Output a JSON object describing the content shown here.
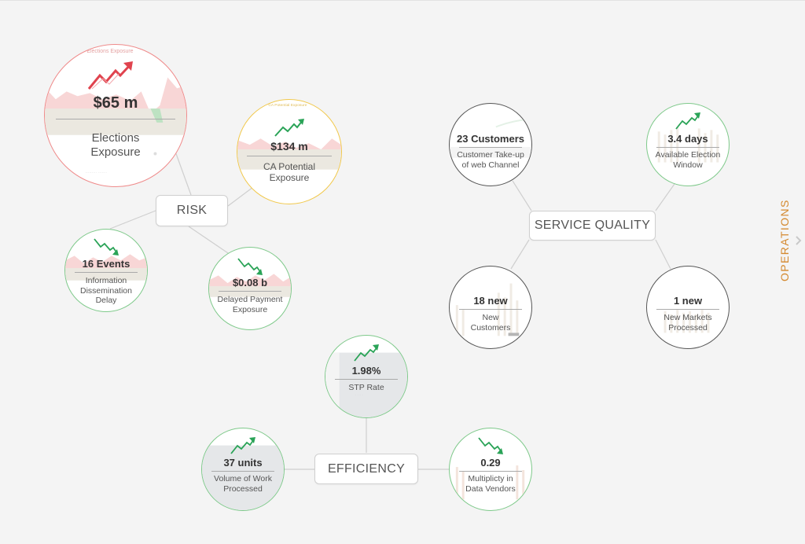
{
  "colors": {
    "up_arrow": "#2aa357",
    "down_arrow": "#2aa357",
    "red_arrow": "#e0434e",
    "green_ring": "#7ec98a",
    "red_ring": "#ef8a8a",
    "yellow_ring": "#f1c84b",
    "dark_ring": "#555555",
    "operations": "#d4892f"
  },
  "hubs": {
    "risk": "RISK",
    "service_quality": "SERVICE QUALITY",
    "efficiency": "EFFICIENCY"
  },
  "kpis": {
    "elections_exposure": {
      "value": "$65 m",
      "label": "Elections Exposure",
      "trend_icon": "trend-up-red-icon"
    },
    "ca_potential_exposure": {
      "value": "$134 m",
      "label": "CA Potential Exposure",
      "trend_icon": "trend-up-icon"
    },
    "information_dissemination_delay": {
      "value": "16 Events",
      "label": "Information Dissemination Delay",
      "trend_icon": "trend-down-icon"
    },
    "delayed_payment_exposure": {
      "value": "$0.08 b",
      "label": "Delayed Payment Exposure",
      "trend_icon": "trend-down-icon"
    },
    "customer_takeup": {
      "value": "23 Customers",
      "label": "Customer Take-up of web Channel"
    },
    "available_election_window": {
      "value": "3.4 days",
      "label": "Available Election Window",
      "trend_icon": "trend-up-icon"
    },
    "new_customers": {
      "value": "18 new",
      "label": "New Customers"
    },
    "new_markets_processed": {
      "value": "1 new",
      "label": "New Markets Processed"
    },
    "stp_rate": {
      "value": "1.98%",
      "label": "STP Rate",
      "trend_icon": "trend-up-icon"
    },
    "volume_of_work_processed": {
      "value": "37 units",
      "label": "Volume of Work Processed",
      "trend_icon": "trend-up-icon"
    },
    "multiplicity_in_data_vendors": {
      "value": "0.29",
      "label": "Multiplicty in Data Vendors",
      "trend_icon": "trend-down-icon"
    }
  },
  "side_tab": {
    "label": "OPERATIONS",
    "icon": "chevron-right-icon"
  }
}
